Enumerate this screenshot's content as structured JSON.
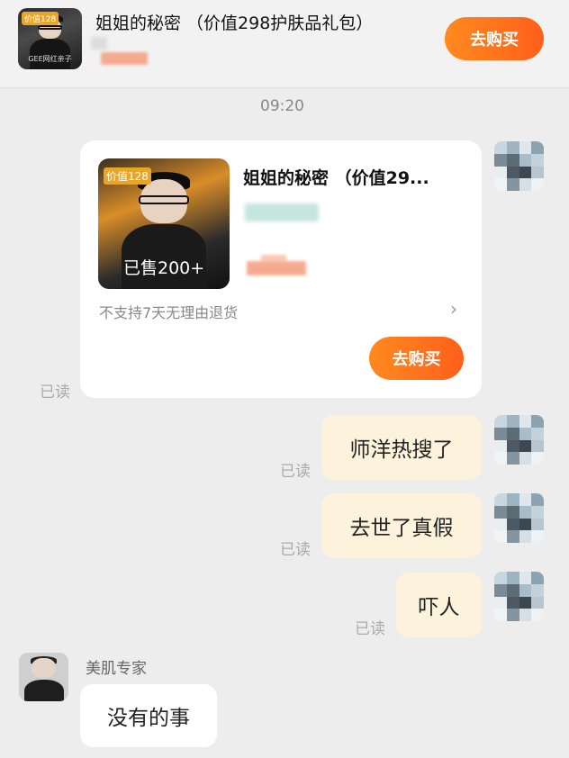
{
  "header": {
    "thumb_tag": "价值128",
    "thumb_caption": "GEE网红亲子",
    "title": "姐姐的秘密 （价值298护肤品礼包）",
    "buy_label": "去购买"
  },
  "timestamp": "09:20",
  "product_card": {
    "thumb_tag": "价值128",
    "sold_label": "已售200+",
    "title": "姐姐的秘密 （价值29...",
    "policy": "不支持7天无理由退货",
    "chevron": "›",
    "buy_label": "去购买",
    "read_label": "已读"
  },
  "messages": [
    {
      "text": "师洋热搜了",
      "read": "已读"
    },
    {
      "text": "去世了真假",
      "read": "已读"
    },
    {
      "text": "吓人",
      "read": "已读"
    }
  ],
  "reply": {
    "sender": "美肌专家",
    "text": "没有的事"
  },
  "colors": {
    "accent_start": "#ff8a1f",
    "accent_end": "#ff5f1a",
    "my_bubble": "#fdf3dc",
    "background": "#ededed"
  }
}
